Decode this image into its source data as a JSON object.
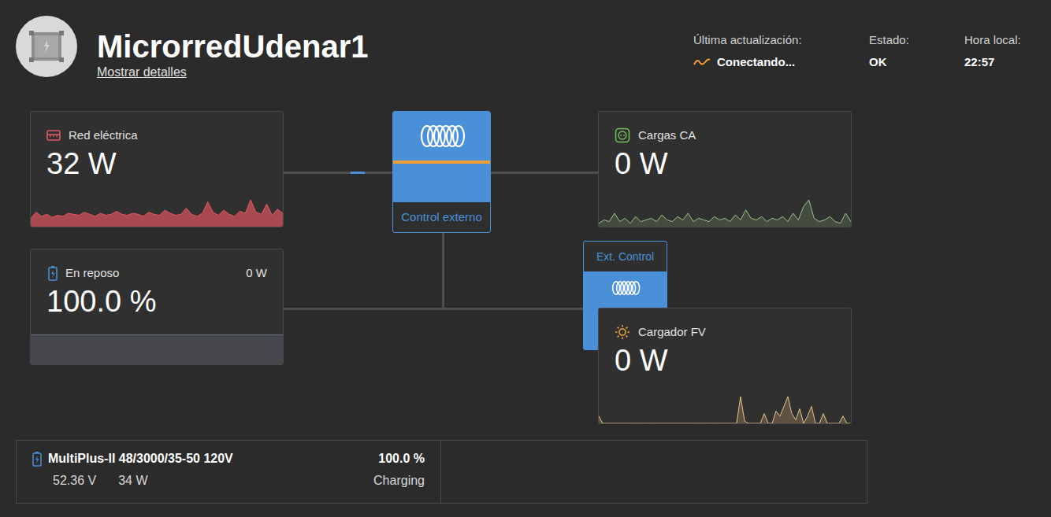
{
  "site": {
    "name": "MicrorredUdenar1",
    "details_link": "Mostrar detalles"
  },
  "status": [
    {
      "label": "Última actualización:",
      "value": "Conectando...",
      "kind": "connecting"
    },
    {
      "label": "Estado:",
      "value": "OK",
      "kind": "plain"
    },
    {
      "label": "Hora local:",
      "value": "22:57",
      "kind": "plain"
    }
  ],
  "grid": {
    "title": "Red eléctrica",
    "value": "32 W",
    "color": "#e05a62",
    "series": [
      8,
      14,
      10,
      12,
      9,
      11,
      10,
      13,
      12,
      11,
      14,
      12,
      10,
      13,
      11,
      12,
      15,
      12,
      11,
      13,
      12,
      10,
      14,
      12,
      11,
      16,
      13,
      11,
      12,
      18,
      12,
      10,
      13,
      24,
      14,
      11,
      16,
      12,
      10,
      15,
      13,
      26,
      14,
      12,
      22,
      11,
      17,
      13
    ]
  },
  "battery": {
    "title": "En reposo",
    "power": "0 W",
    "value": "100.0 %"
  },
  "inverter": {
    "label": "Control externo"
  },
  "ext_control": {
    "label": "Ext. Control"
  },
  "loads": {
    "title": "Cargas CA",
    "value": "0 W",
    "color": "#9cc48a",
    "series": [
      2,
      4,
      3,
      8,
      3,
      5,
      2,
      6,
      3,
      4,
      5,
      3,
      7,
      4,
      3,
      6,
      4,
      8,
      3,
      5,
      4,
      3,
      6,
      4,
      5,
      3,
      7,
      4,
      10,
      5,
      4,
      6,
      3,
      5,
      4,
      6,
      3,
      8,
      4,
      12,
      16,
      5,
      3,
      4,
      6,
      3,
      2,
      8,
      3
    ]
  },
  "pv": {
    "title": "Cargador FV",
    "value": "0 W",
    "color": "#e8c48a",
    "series": [
      6,
      0,
      0,
      0,
      0,
      0,
      0,
      0,
      0,
      0,
      0,
      0,
      0,
      0,
      0,
      0,
      0,
      0,
      0,
      0,
      0,
      0,
      0,
      0,
      0,
      0,
      0,
      0,
      0,
      0,
      0,
      0,
      0,
      0,
      0,
      0,
      22,
      2,
      0,
      0,
      0,
      0,
      8,
      0,
      0,
      10,
      6,
      14,
      22,
      8,
      3,
      12,
      0,
      6,
      14,
      0,
      0,
      8,
      0,
      0,
      0,
      0,
      6,
      0,
      0
    ]
  },
  "devices": [
    {
      "name": "MultiPlus-II 48/3000/35-50 120V",
      "voltage": "52.36 V",
      "power": "34 W",
      "soc": "100.0 %",
      "state": "Charging"
    }
  ]
}
